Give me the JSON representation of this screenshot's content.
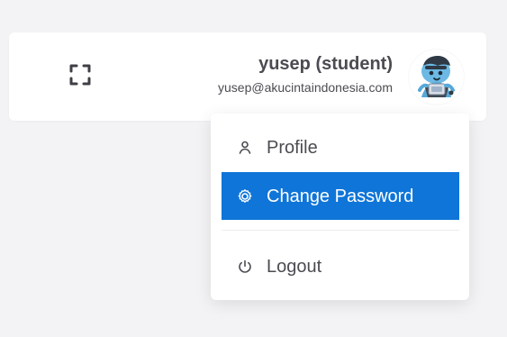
{
  "colors": {
    "page_background": "#f3f3f5",
    "card_background": "#ffffff",
    "text_primary": "#4b4b52",
    "active_menu_background": "#0f75d8",
    "active_menu_text": "#ffffff"
  },
  "header": {
    "user": {
      "name": "yusep (student)",
      "email": "yusep@akucintaindonesia.com"
    },
    "icons": {
      "fullscreen": "fullscreen-icon",
      "avatar": "avatar-illustration"
    }
  },
  "menu": {
    "items": [
      {
        "label": "Profile",
        "icon": "user-icon"
      },
      {
        "label": "Change Password",
        "icon": "gear-icon"
      },
      {
        "label": "Logout",
        "icon": "power-icon"
      }
    ]
  }
}
